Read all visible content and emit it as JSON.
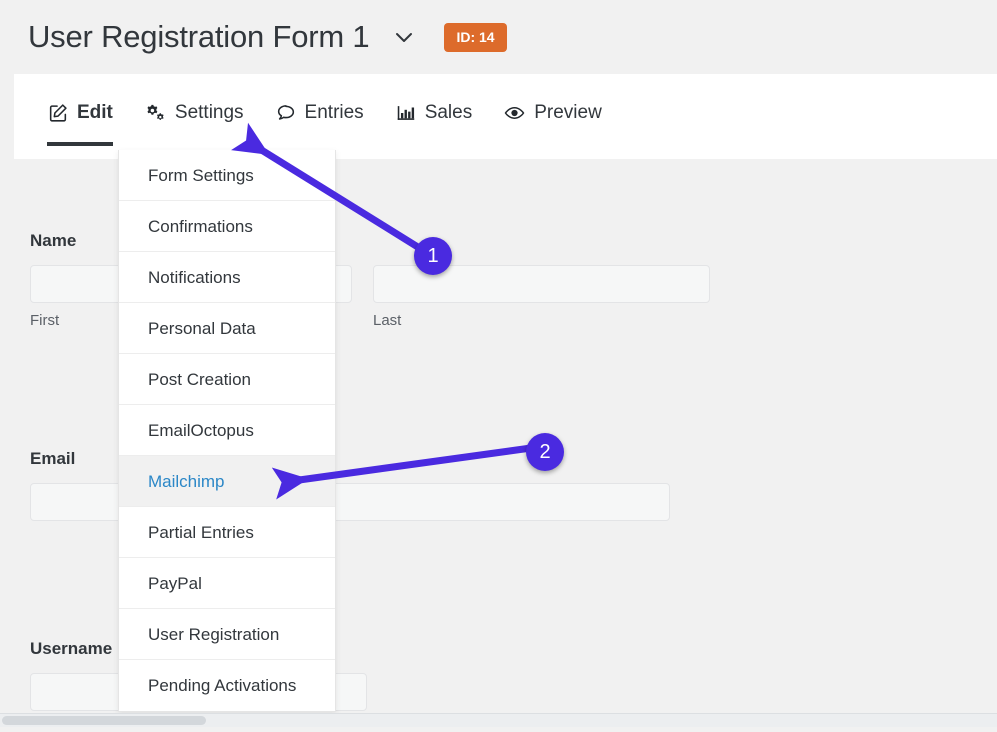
{
  "header": {
    "title": "User Registration Form 1",
    "chevron_icon": "chevron-down-icon",
    "id_badge": "ID: 14",
    "badge_color": "#dd6b2b"
  },
  "tabs": [
    {
      "label": "Edit",
      "icon": "edit-pencil-icon",
      "active": true
    },
    {
      "label": "Settings",
      "icon": "cogs-icon",
      "active": false
    },
    {
      "label": "Entries",
      "icon": "comment-icon",
      "active": false
    },
    {
      "label": "Sales",
      "icon": "bar-chart-icon",
      "active": false
    },
    {
      "label": "Preview",
      "icon": "eye-icon",
      "active": false
    }
  ],
  "settings_menu": {
    "items": [
      {
        "label": "Form Settings",
        "highlighted": false
      },
      {
        "label": "Confirmations",
        "highlighted": false
      },
      {
        "label": "Notifications",
        "highlighted": false
      },
      {
        "label": "Personal Data",
        "highlighted": false
      },
      {
        "label": "Post Creation",
        "highlighted": false
      },
      {
        "label": "EmailOctopus",
        "highlighted": false
      },
      {
        "label": "Mailchimp",
        "highlighted": true
      },
      {
        "label": "Partial Entries",
        "highlighted": false
      },
      {
        "label": "PayPal",
        "highlighted": false
      },
      {
        "label": "User Registration",
        "highlighted": false
      },
      {
        "label": "Pending Activations",
        "highlighted": false
      }
    ],
    "highlight_text_color": "#2b87c7",
    "highlight_bg_color": "#f1f1f1"
  },
  "form": {
    "fields": [
      {
        "label": "Name",
        "value": "",
        "sub_first": "First",
        "sub_last": "Last"
      },
      {
        "label": "Email",
        "value": ""
      },
      {
        "label": "Username",
        "value": ""
      }
    ]
  },
  "annotations": {
    "accent_color": "#4a2ae0",
    "callouts": [
      {
        "number": "1",
        "points_to": "Settings tab"
      },
      {
        "number": "2",
        "points_to": "Mailchimp menu item"
      }
    ]
  }
}
